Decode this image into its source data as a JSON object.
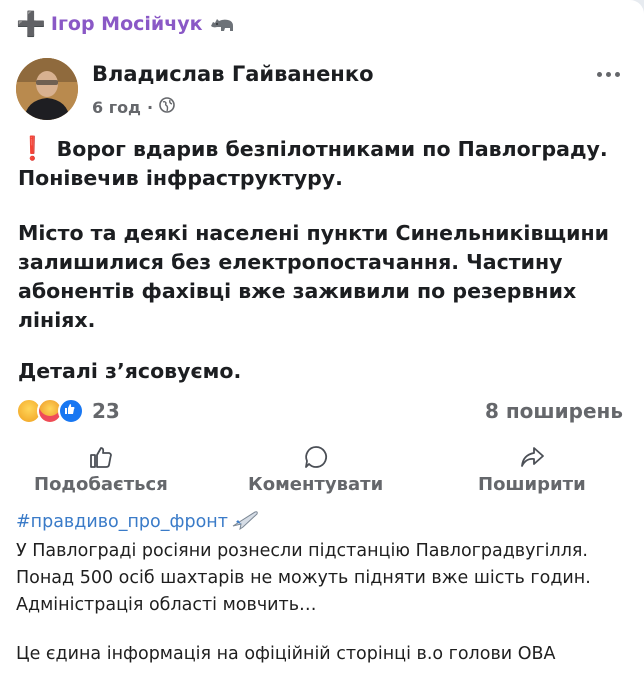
{
  "forward": {
    "prefix": "➕",
    "name": "Ігор Мосійчук",
    "emoji_icon": "rhino-icon"
  },
  "post": {
    "author": "Владислав Гайваненко",
    "time": "6 год",
    "separator": "·",
    "visibility_icon": "globe-icon",
    "exclamation": "❗",
    "paragraphs": [
      "Ворог вдарив безпілотниками по Павлограду. Понівечив інфраструктуру.",
      "Місто та деякі населені пункти Синельниківщини залишилися без електропостачання. Частину абонентів фахівці вже заживили по резервних лініях.",
      "Деталі з’ясовуємо."
    ],
    "reaction_icons": [
      "sad-react-icon",
      "care-react-icon",
      "like-react-icon"
    ],
    "reaction_count": "23",
    "shares": "8 поширень",
    "actions": {
      "like": "Подобається",
      "comment": "Коментувати",
      "share": "Поширити"
    }
  },
  "message": {
    "hashtag": "#правдиво_про_фронт",
    "hashtag_emoji": "airplane-icon",
    "lines": [
      "У Павлограді росіяни рознесли підстанцію Павлоградвугілля.",
      "Понад 500 осіб шахтарів не можуть підняти вже шість годин.",
      "Адміністрація області мовчить…",
      "Це єдина інформація на офіційній сторінці в.о голови ОВА"
    ]
  },
  "colors": {
    "forward_name": "#8a58c6",
    "hashtag": "#3a7bc8",
    "exclamation": "#e0242e",
    "meta_gray": "#65676b"
  }
}
